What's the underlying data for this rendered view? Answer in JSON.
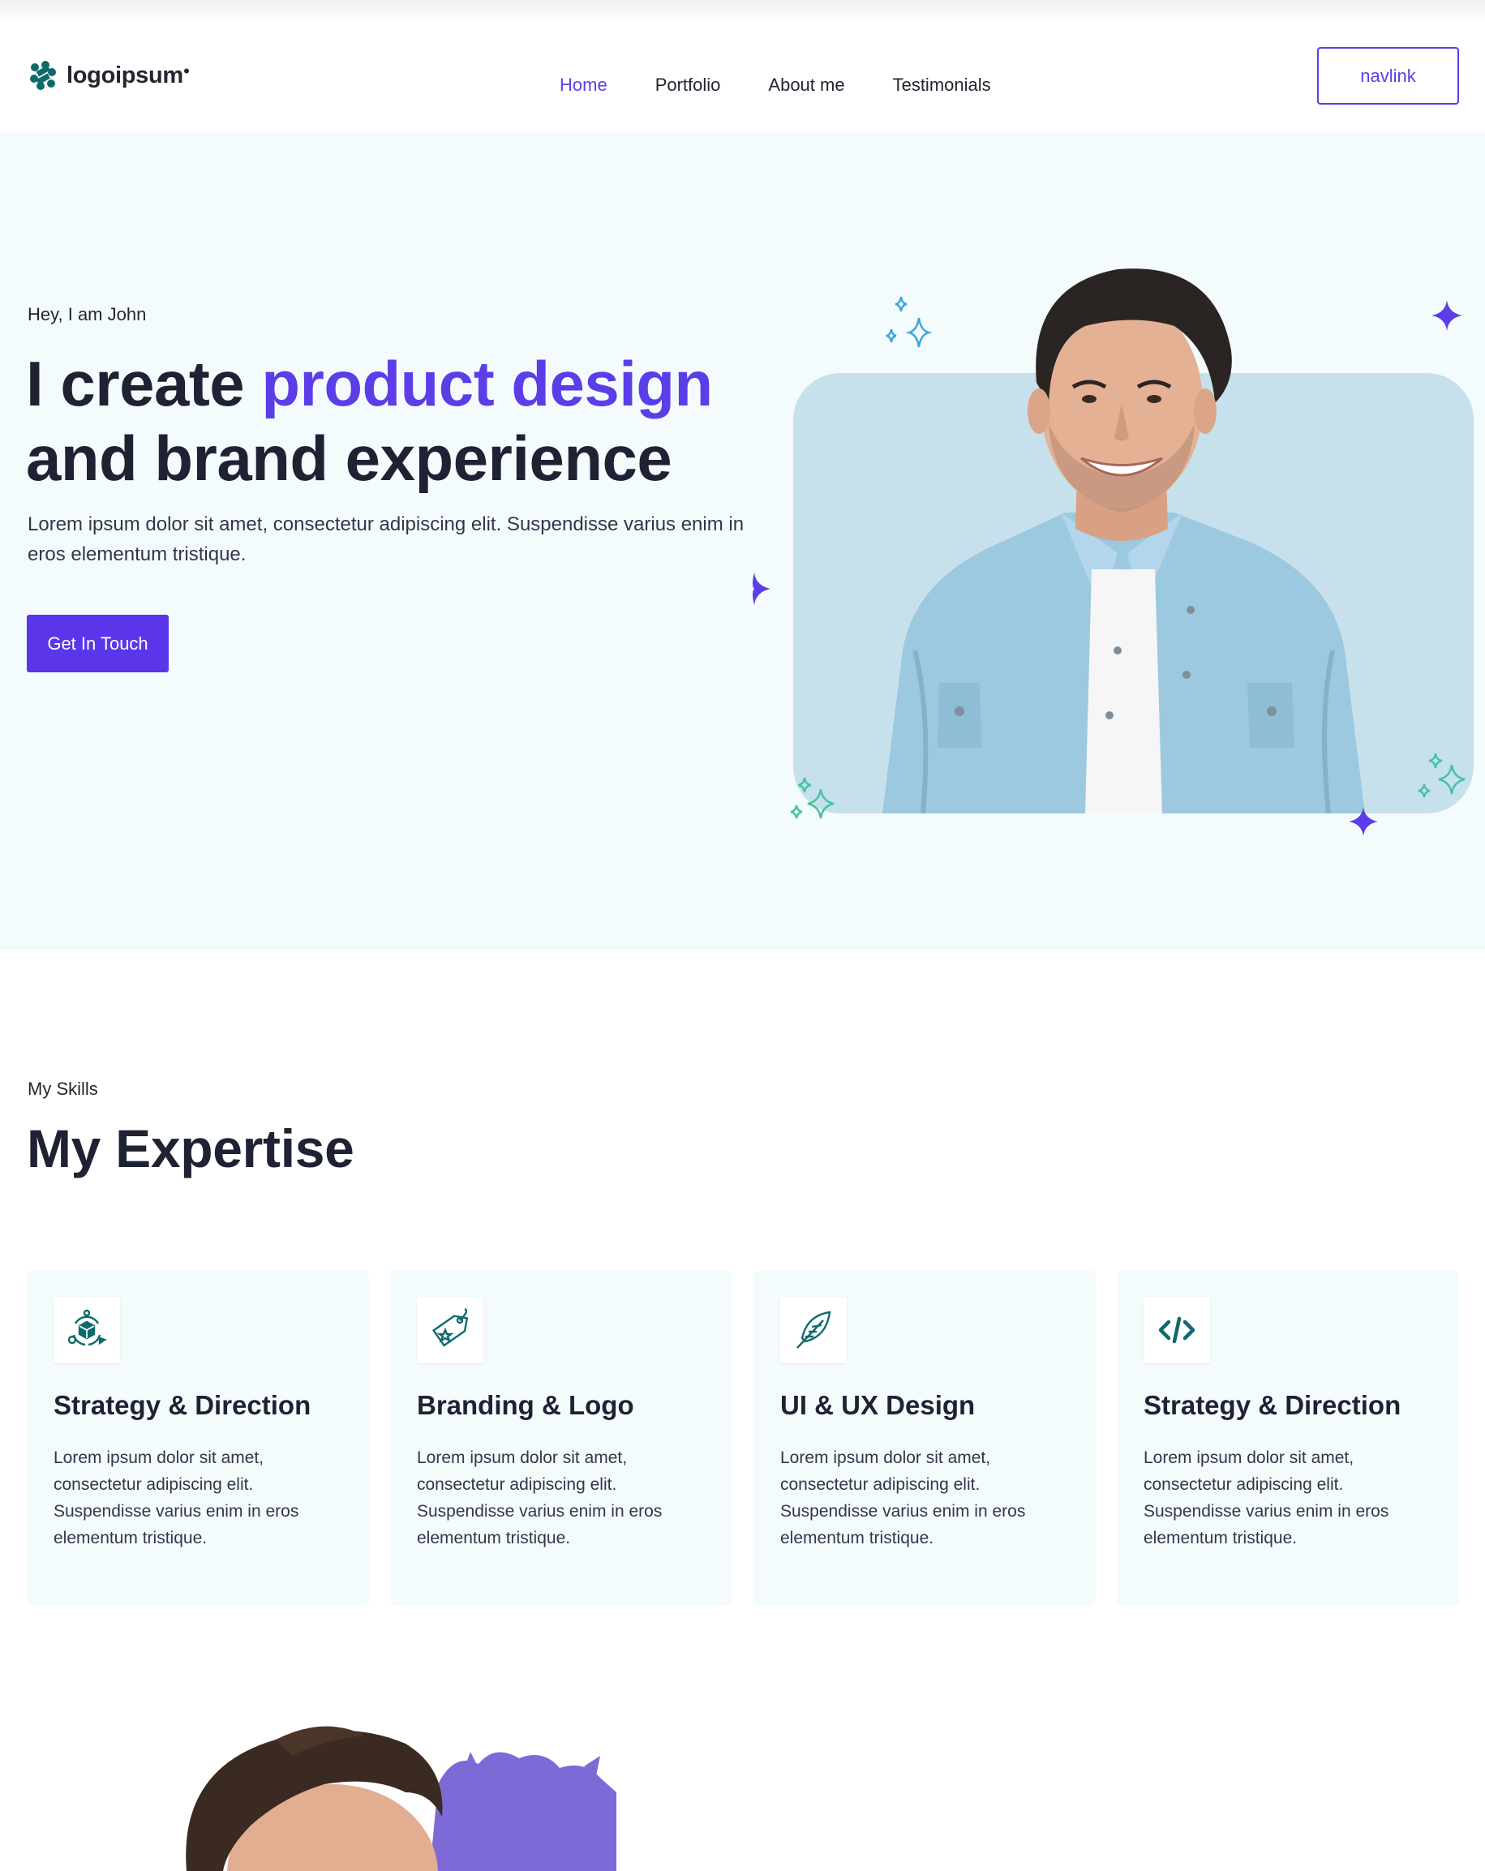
{
  "header": {
    "logo_text": "logoipsum",
    "nav": [
      {
        "label": "Home",
        "active": true
      },
      {
        "label": "Portfolio",
        "active": false
      },
      {
        "label": "About me",
        "active": false
      },
      {
        "label": "Testimonials",
        "active": false
      }
    ],
    "nav_button": "navlink"
  },
  "hero": {
    "eyebrow": "Hey, I am John",
    "title_start": "I create ",
    "title_accent": "product design",
    "title_end": "and brand experience",
    "description": "Lorem ipsum dolor sit amet, consectetur adipiscing elit. Suspendisse varius enim in eros elementum tristique.",
    "cta": "Get In Touch"
  },
  "skills": {
    "eyebrow": "My Skills",
    "heading": "My Expertise",
    "cards": [
      {
        "icon": "strategy-icon",
        "title": "Strategy & Direction",
        "text": "Lorem ipsum dolor sit amet, consectetur adipiscing elit. Suspendisse varius enim in eros elementum tristique."
      },
      {
        "icon": "tag-icon",
        "title": "Branding & Logo",
        "text": "Lorem ipsum dolor sit amet, consectetur adipiscing elit. Suspendisse varius enim in eros elementum tristique."
      },
      {
        "icon": "feather-icon",
        "title": "UI & UX Design",
        "text": "Lorem ipsum dolor sit amet, consectetur adipiscing elit. Suspendisse varius enim in eros elementum tristique."
      },
      {
        "icon": "code-icon",
        "title": "Strategy & Direction",
        "text": "Lorem ipsum dolor sit amet, consectetur adipiscing elit. Suspendisse varius enim in eros elementum tristique."
      }
    ]
  },
  "colors": {
    "accent": "#5b3ee8",
    "hero_bg": "#f4fbfd",
    "card_bg": "#f4fbfd",
    "photo_bg": "#c7e1ec",
    "icon_teal": "#0f6b6b"
  }
}
